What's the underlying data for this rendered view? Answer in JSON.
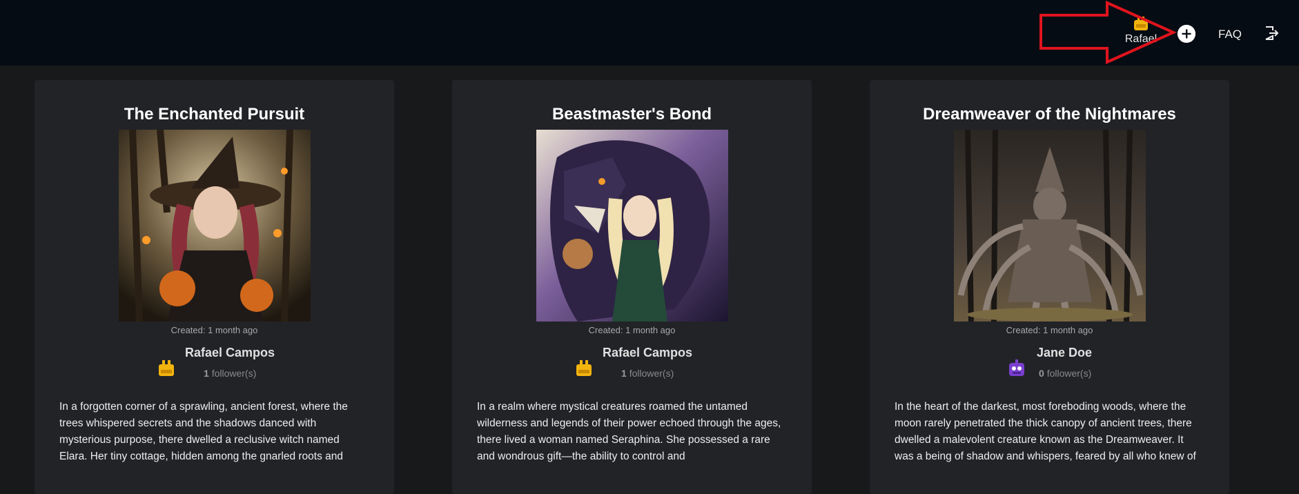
{
  "header": {
    "user_name": "Rafael",
    "faq_label": "FAQ",
    "icons": {
      "add": "plus-circle-icon",
      "logout": "logout-icon",
      "user_avatar": "yellow-robot-avatar-icon"
    },
    "annotation_color": "#e0141e"
  },
  "cards": [
    {
      "title": "The Enchanted Pursuit",
      "created": "Created: 1 month ago",
      "author_name": "Rafael Campos",
      "followers_count": "1",
      "followers_label": "follower(s)",
      "avatar_color": "#f2b40e",
      "story": "In a forgotten corner of a sprawling, ancient forest, where the trees whispered secrets and the shadows danced with mysterious purpose, there dwelled a reclusive witch named Elara. Her tiny cottage, hidden among the gnarled roots and"
    },
    {
      "title": "Beastmaster's Bond",
      "created": "Created: 1 month ago",
      "author_name": "Rafael Campos",
      "followers_count": "1",
      "followers_label": "follower(s)",
      "avatar_color": "#f2b40e",
      "story": "In a realm where mystical creatures roamed the untamed wilderness and legends of their power echoed through the ages, there lived a woman named Seraphina. She possessed a rare and wondrous gift—the ability to control and"
    },
    {
      "title": "Dreamweaver of the Nightmares",
      "created": "Created: 1 month ago",
      "author_name": "Jane Doe",
      "followers_count": "0",
      "followers_label": "follower(s)",
      "avatar_color": "#7a3fcf",
      "story": "In the heart of the darkest, most foreboding woods, where the moon rarely penetrated the thick canopy of ancient trees, there dwelled a malevolent creature known as the Dreamweaver. It was a being of shadow and whispers, feared by all who knew of"
    }
  ]
}
